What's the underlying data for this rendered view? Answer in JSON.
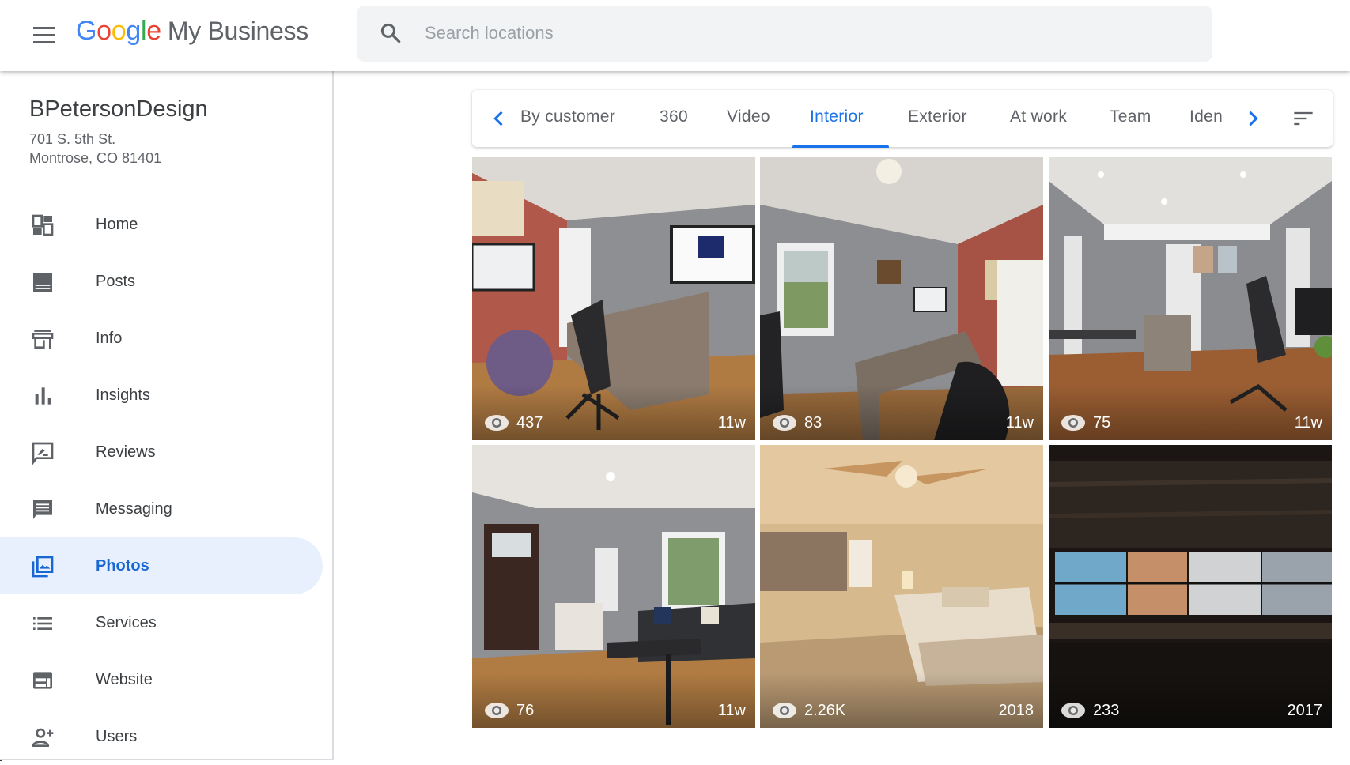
{
  "header": {
    "menu_icon": "hamburger-menu-icon",
    "logo_google": [
      "G",
      "o",
      "o",
      "g",
      "l",
      "e"
    ],
    "logo_product": "My Business",
    "search_placeholder": "Search locations",
    "search_value": "",
    "search_icon": "search-icon"
  },
  "business": {
    "name": "BPetersonDesign",
    "address_line1": "701 S. 5th St.",
    "address_line2": "Montrose, CO 81401"
  },
  "sidebar": {
    "items": [
      {
        "label": "Home",
        "icon": "dashboard-icon",
        "active": false
      },
      {
        "label": "Posts",
        "icon": "posts-icon",
        "active": false
      },
      {
        "label": "Info",
        "icon": "storefront-icon",
        "active": false
      },
      {
        "label": "Insights",
        "icon": "bar-chart-icon",
        "active": false
      },
      {
        "label": "Reviews",
        "icon": "rate-review-icon",
        "active": false
      },
      {
        "label": "Messaging",
        "icon": "message-icon",
        "active": false
      },
      {
        "label": "Photos",
        "icon": "photo-library-icon",
        "active": true
      },
      {
        "label": "Services",
        "icon": "list-icon",
        "active": false
      },
      {
        "label": "Website",
        "icon": "website-icon",
        "active": false
      },
      {
        "label": "Users",
        "icon": "person-add-icon",
        "active": false
      }
    ]
  },
  "tabs": {
    "items": [
      {
        "label": "By customer",
        "active": false
      },
      {
        "label": "360",
        "active": false
      },
      {
        "label": "Video",
        "active": false
      },
      {
        "label": "Interior",
        "active": true
      },
      {
        "label": "Exterior",
        "active": false
      },
      {
        "label": "At work",
        "active": false
      },
      {
        "label": "Team",
        "active": false
      },
      {
        "label": "Iden",
        "active": false
      }
    ],
    "prev_icon": "chevron-left-icon",
    "next_icon": "chevron-right-icon",
    "sort_icon": "sort-icon"
  },
  "colors": {
    "accent": "#1a73e8",
    "active_bg": "#e8f0fe",
    "search_bg": "#f1f3f4",
    "icon_gray": "#5f6368"
  },
  "photos": [
    {
      "views": "437",
      "age": "11w",
      "description": "Office with brick wall, BPD logo screen, desk and exercise ball"
    },
    {
      "views": "83",
      "age": "11w",
      "description": "Office with window, brick wall, desk and black chairs"
    },
    {
      "views": "75",
      "age": "11w",
      "description": "Gray office with recessed lights, desks and chairs"
    },
    {
      "views": "76",
      "age": "11w",
      "description": "Living room with front door, sofa and coffee table"
    },
    {
      "views": "2.26K",
      "age": "2018",
      "description": "Bedroom with ceiling fan, bed and patterned blinds"
    },
    {
      "views": "233",
      "age": "2017",
      "description": "Dark room with wooden wall and multiple monitors"
    }
  ]
}
